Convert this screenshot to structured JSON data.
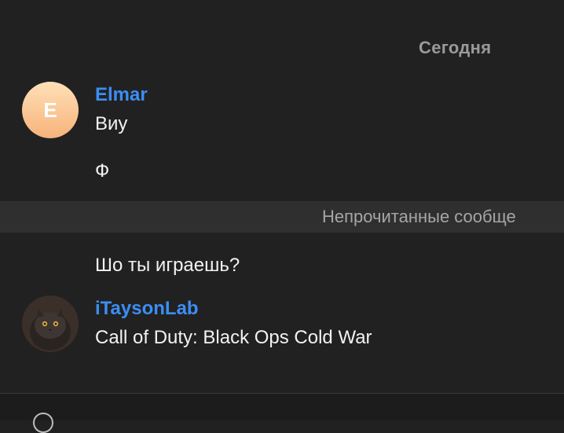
{
  "date_separator": "Сегодня",
  "messages": [
    {
      "sender": "Elmar",
      "avatar_letter": "E",
      "lines": [
        "Виу",
        "Ф"
      ]
    },
    {
      "text": "Шо ты играешь?"
    },
    {
      "sender": "iTaysonLab",
      "avatar_icon": "cat-photo-icon",
      "lines": [
        "Call of Duty: Black Ops Cold War"
      ]
    }
  ],
  "unread_label": "Непрочитанные сообще",
  "colors": {
    "background": "#212121",
    "sender": "#3b8ef5",
    "unread_bar": "#2f2f2f"
  }
}
